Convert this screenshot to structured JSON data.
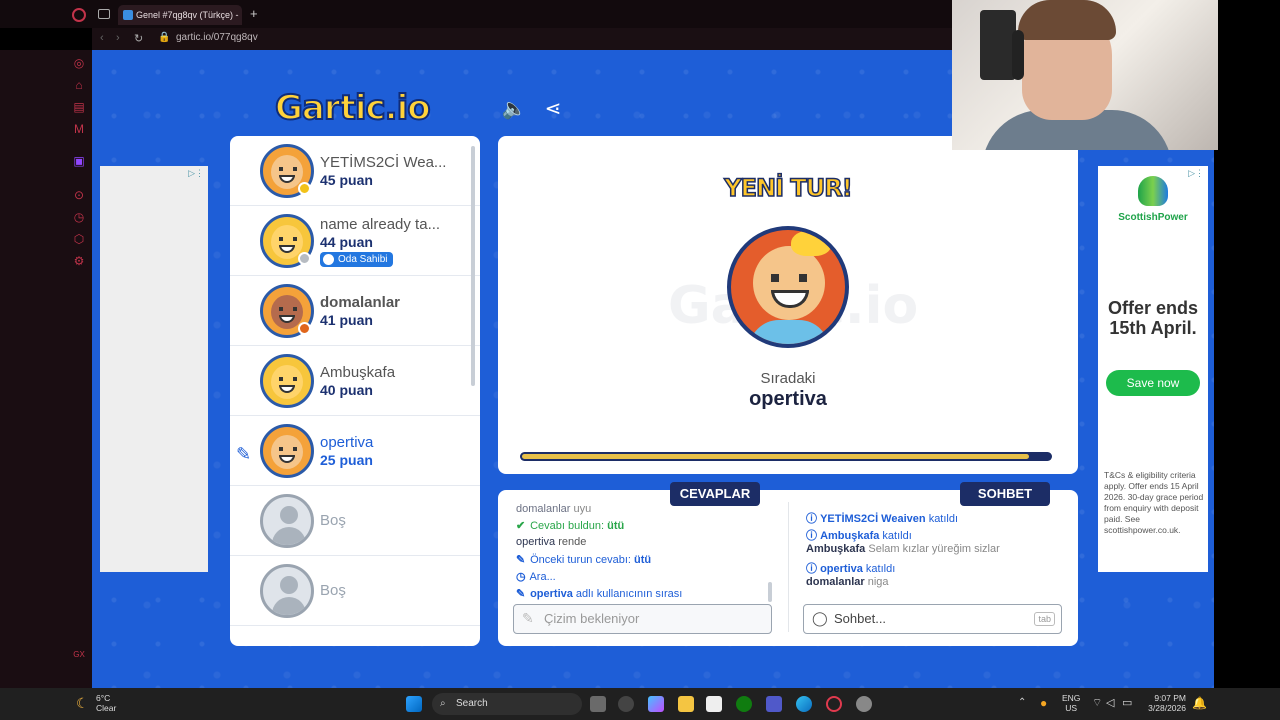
{
  "browser": {
    "tab_title": "Genel #7qg8qv (Türkçe) -",
    "new_tab": "+",
    "url": "gartic.io/077qg8qv"
  },
  "game": {
    "logo": "Gartic.io",
    "players": [
      {
        "name": "YETİMS2Cİ Weaiven",
        "display": "YETİMS2Cİ Wea...",
        "score": "45 puan",
        "dot_color": "#f2c21a",
        "avatar": "orange"
      },
      {
        "name": "name already taken",
        "display": "name already ta...",
        "score": "44 puan",
        "badge": "Oda Sahibi",
        "dot_color": "#b7bcc2",
        "avatar": "yellow"
      },
      {
        "name": "domalanlar",
        "display": "domalanlar",
        "score": "41 puan",
        "dot_color": "#e0661c",
        "avatar": "dark"
      },
      {
        "name": "Ambuşkafa",
        "display": "Ambuşkafa",
        "score": "40 puan",
        "avatar": "yellow"
      },
      {
        "name": "opertiva",
        "display": "opertiva",
        "score": "25 puan",
        "avatar": "orange",
        "drawing": true
      },
      {
        "name": "Boş",
        "display": "Boş",
        "empty": true
      },
      {
        "name": "Boş",
        "display": "Boş",
        "empty": true
      }
    ],
    "round_title": "YENİ TUR!",
    "next_label": "Sıradaki",
    "next_player": "opertiva",
    "timer_fraction": 0.96,
    "answers_tab": "CEVAPLAR",
    "chat_tab": "SOHBET",
    "answers": [
      {
        "user": "domalanlar",
        "text": "uyu"
      },
      {
        "icon": "✔",
        "prefix": "Cevabı buldun: ",
        "highlight": "ütü",
        "kind": "green"
      },
      {
        "user": "opertiva",
        "text": "rende"
      },
      {
        "icon": "✎",
        "prefix": "Önceki turun cevabı: ",
        "highlight": "ütü",
        "kind": "blue"
      },
      {
        "icon": "◷",
        "prefix": "Ara...",
        "highlight": "",
        "kind": "blue"
      },
      {
        "icon": "✎",
        "user_b": "opertiva",
        "prefix": " adlı kullanıcının sırası",
        "kind": "blue"
      }
    ],
    "chat": [
      {
        "icon": "ⓘ",
        "user": "YETİMS2Cİ Weaiven",
        "text": "katıldı",
        "kind": "blue"
      },
      {
        "icon": "ⓘ",
        "user": "Ambuşkafa",
        "text": "katıldı",
        "kind": "blue"
      },
      {
        "user": "Ambuşkafa",
        "text": "Selam kızlar yüreğim sizlar",
        "kind": "plain"
      },
      {
        "icon": "ⓘ",
        "user": "opertiva",
        "text": "katıldı",
        "kind": "blue"
      },
      {
        "user": "domalanlar",
        "text": "niga",
        "kind": "plain"
      }
    ],
    "answer_placeholder": "Çizim bekleniyor",
    "chat_placeholder": "Sohbet...",
    "tab_key": "tab"
  },
  "ad_right": {
    "brand": "ScottishPower",
    "headline_1": "Offer ends",
    "headline_2": "15th April.",
    "button": "Save now",
    "fine_print": "T&Cs & eligibility criteria apply. Offer ends 15 April 2026. 30-day grace period from enquiry with deposit paid. See scottishpower.co.uk."
  },
  "taskbar": {
    "temp": "6°C",
    "condition": "Clear",
    "search": "Search",
    "lang_1": "ENG",
    "lang_2": "US",
    "time": "9:07 PM",
    "date": "3/28/2026"
  },
  "colors": {
    "stage_blue": "#1e5ed7",
    "navy": "#1c2d66",
    "accent_yellow": "#ffc629"
  }
}
